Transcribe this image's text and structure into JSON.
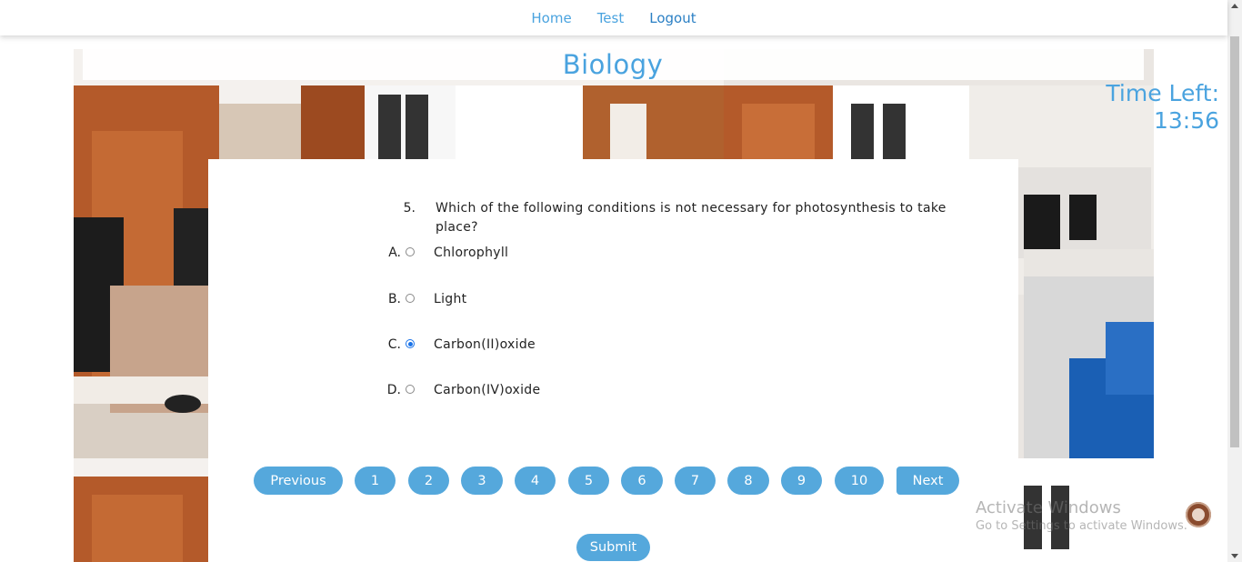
{
  "nav": {
    "items": [
      {
        "label": "Home"
      },
      {
        "label": "Test"
      },
      {
        "label": "Logout"
      }
    ]
  },
  "exam": {
    "subject": "Biology",
    "timer_label": "Time Left:",
    "timer_value": "13:56"
  },
  "question": {
    "number": "5.",
    "text": "Which of the following conditions is not necessary for photosynthesis to take place?",
    "options": [
      {
        "letter": "A.",
        "text": "Chlorophyll",
        "selected": false
      },
      {
        "letter": "B.",
        "text": "Light",
        "selected": false
      },
      {
        "letter": "C.",
        "text": "Carbon(II)oxide",
        "selected": true
      },
      {
        "letter": "D.",
        "text": "Carbon(IV)oxide",
        "selected": false
      }
    ]
  },
  "pagination": {
    "previous": "Previous",
    "pages": [
      "1",
      "2",
      "3",
      "4",
      "5",
      "6",
      "7",
      "8",
      "9",
      "10"
    ],
    "next": "Next"
  },
  "submit_label": "Submit",
  "watermark": {
    "title": "Activate Windows",
    "subtitle": "Go to Settings to activate Windows."
  },
  "colors": {
    "accent": "#4aa3df",
    "button": "#55a8dc",
    "radio_selected": "#1a73e8"
  }
}
